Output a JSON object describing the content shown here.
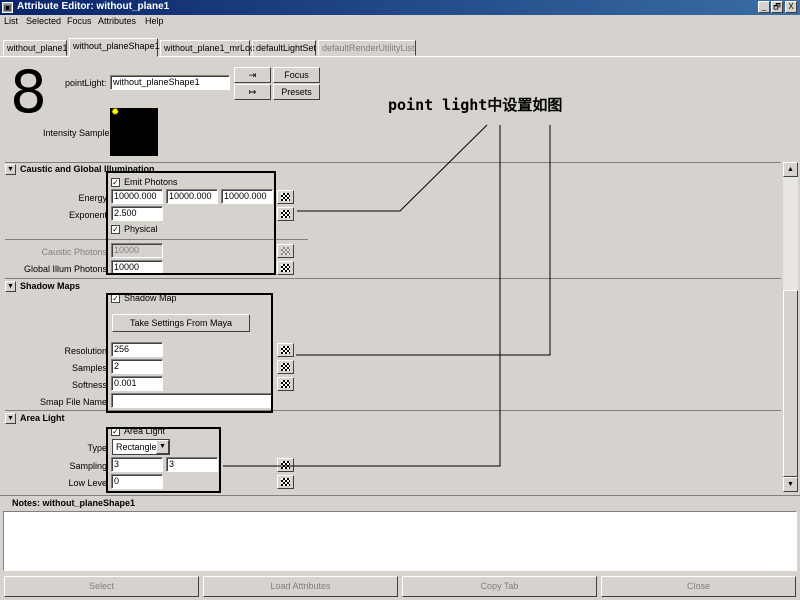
{
  "window": {
    "title": "Attribute Editor: without_plane1",
    "minimize": "_",
    "restore": "🗗",
    "close": "X"
  },
  "menu": [
    "List",
    "Selected",
    "Focus",
    "Attributes",
    "Help"
  ],
  "tabs": [
    "without_plane1",
    "without_planeShape1",
    "without_plane1_mrLoc",
    "defaultLightSet",
    "defaultRenderUtilityList1"
  ],
  "header": {
    "big_number": "8",
    "node_type_label": "pointLight:",
    "node_name": "without_planeShape1",
    "focus_label": "Focus",
    "presets_label": "Presets",
    "intensity_sample_label": "Intensity Sample"
  },
  "caustic": {
    "title": "Caustic and Global Illumination",
    "emit_photons": "Emit Photons",
    "energy_label": "Energy",
    "energy": [
      "10000.000",
      "10000.000",
      "10000.000"
    ],
    "exponent_label": "Exponent",
    "exponent": "2.500",
    "physical": "Physical",
    "caustic_photons_label": "Caustic Photons",
    "caustic_photons": "10000",
    "global_illum_label": "Global Illum Photons",
    "global_illum": "10000"
  },
  "shadow": {
    "title": "Shadow Maps",
    "shadow_map": "Shadow Map",
    "take_settings": "Take Settings From Maya",
    "resolution_label": "Resolution",
    "resolution": "256",
    "samples_label": "Samples",
    "samples": "2",
    "softness_label": "Softness",
    "softness": "0.001",
    "smap_label": "Smap File Name",
    "smap": ""
  },
  "area": {
    "title": "Area Light",
    "area_light": "Area Light",
    "type_label": "Type",
    "type_value": "Rectangle",
    "sampling_label": "Sampling",
    "sampling": [
      "3",
      "3"
    ],
    "low_level_label": "Low Leve",
    "low_level": "0"
  },
  "notes": {
    "title": "Notes: without_planeShape1",
    "text": ""
  },
  "bottom_buttons": [
    "Select",
    "Load Attributes",
    "Copy Tab",
    "Close"
  ],
  "annotation": "point light中设置如图"
}
